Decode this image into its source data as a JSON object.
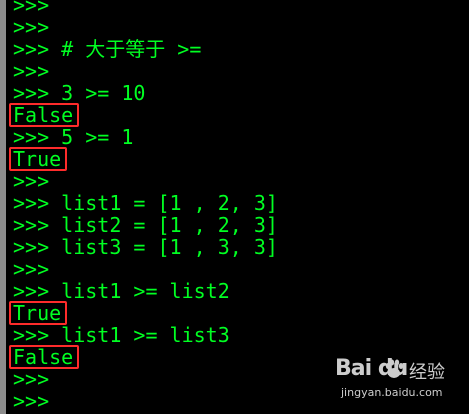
{
  "terminal": {
    "lines": [
      {
        "text": ">>>",
        "highlight": false
      },
      {
        "text": ">>>",
        "highlight": false
      },
      {
        "text": ">>> # 大于等于 >=",
        "highlight": false
      },
      {
        "text": ">>>",
        "highlight": false
      },
      {
        "text": ">>> 3 >= 10",
        "highlight": false
      },
      {
        "text": "False",
        "highlight": true
      },
      {
        "text": ">>> 5 >= 1",
        "highlight": false
      },
      {
        "text": "True",
        "highlight": true
      },
      {
        "text": ">>>",
        "highlight": false
      },
      {
        "text": ">>> list1 = [1 , 2, 3]",
        "highlight": false
      },
      {
        "text": ">>> list2 = [1 , 2, 3]",
        "highlight": false
      },
      {
        "text": ">>> list3 = [1 , 3, 3]",
        "highlight": false
      },
      {
        "text": ">>>",
        "highlight": false
      },
      {
        "text": ">>> list1 >= list2",
        "highlight": false
      },
      {
        "text": "True",
        "highlight": true
      },
      {
        "text": ">>> list1 >= list3",
        "highlight": false
      },
      {
        "text": "False",
        "highlight": true
      },
      {
        "text": ">>>",
        "highlight": false
      },
      {
        "text": ">>>",
        "highlight": false
      }
    ]
  },
  "watermark": {
    "logo": "Bai du",
    "brand_cn": "经验",
    "url": "jingyan.baidu.com"
  },
  "colors": {
    "background": "#000000",
    "text": "#00ff22",
    "highlight_box": "#ff2b2b",
    "scrollbar": "#8c8c8c"
  }
}
